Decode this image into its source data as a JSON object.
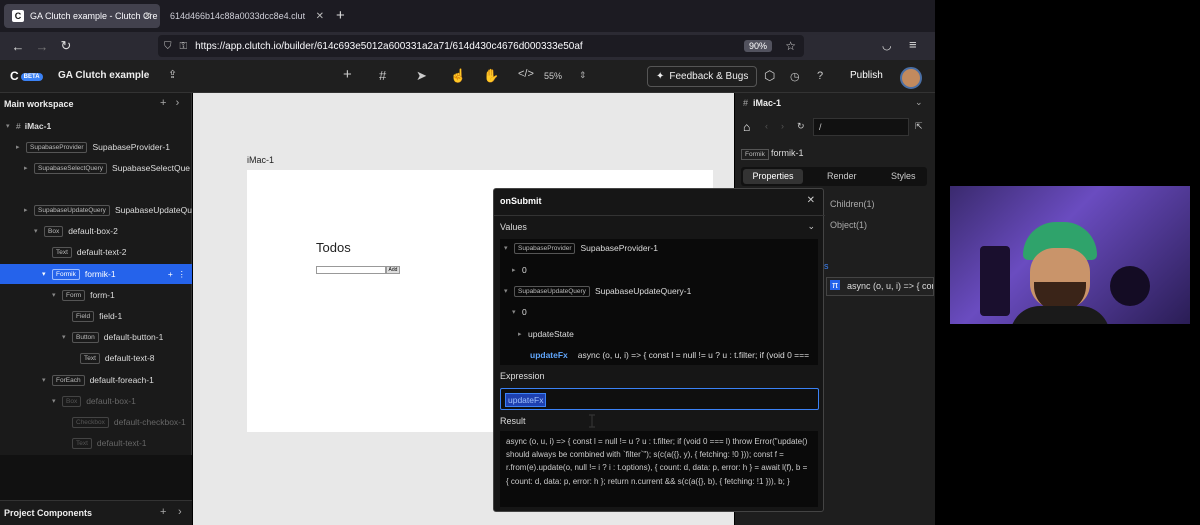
{
  "browser": {
    "tabs": [
      {
        "title": "GA Clutch example - Clutch Cre",
        "favicon": "C"
      },
      {
        "title": "614d466b14c88a0033dcc8e4.clut"
      }
    ],
    "url": "https://app.clutch.io/builder/614c693e5012a600331a2a71/614d430c4676d000333e50af",
    "zoom": "90%"
  },
  "appbar": {
    "logo": "C",
    "badge": "BETA",
    "project": "GA Clutch example",
    "zoom": "55%",
    "feedback": "Feedback & Bugs",
    "publish": "Publish"
  },
  "left": {
    "workspace": "Main workspace",
    "root": "iMac-1",
    "tree": [
      {
        "tag": "SupabaseProvider",
        "label": "SupabaseProvider-1"
      },
      {
        "tag": "SupabaseSelectQuery",
        "label": "SupabaseSelectQue"
      },
      {
        "tag": "SupabaseUpdateQuery",
        "label": "SupabaseUpdateQu"
      },
      {
        "tag": "Box",
        "label": "default-box-2"
      },
      {
        "tag": "Text",
        "label": "default-text-2"
      },
      {
        "tag": "Formik",
        "label": "formik-1"
      },
      {
        "tag": "Form",
        "label": "form-1"
      },
      {
        "tag": "Field",
        "label": "field-1"
      },
      {
        "tag": "Button",
        "label": "default-button-1"
      },
      {
        "tag": "Text",
        "label": "default-text-8"
      },
      {
        "tag": "ForEach",
        "label": "default-foreach-1"
      },
      {
        "tag": "Box",
        "label": "default-box-1"
      },
      {
        "tag": "Checkbox",
        "label": "default-checkbox-1"
      },
      {
        "tag": "Text",
        "label": "default-text-1"
      }
    ],
    "project_components": "Project Components"
  },
  "canvas": {
    "artboard": "iMac-1",
    "heading": "Todos",
    "add_button": "Add"
  },
  "right": {
    "title": "iMac-1",
    "path": "/",
    "component_tag": "Formik",
    "component_name": "formik-1",
    "tabs": [
      "Properties",
      "Render",
      "Styles"
    ],
    "children": "Children(1)",
    "object": "Object(1)",
    "fn_preview": "async (o, u, i) => { cons"
  },
  "modal": {
    "title": "onSubmit",
    "values_label": "Values",
    "values": [
      {
        "tag": "SupabaseProvider",
        "label": "SupabaseProvider-1"
      },
      {
        "label": "0"
      },
      {
        "tag": "SupabaseUpdateQuery",
        "label": "SupabaseUpdateQuery-1"
      },
      {
        "label": "0"
      },
      {
        "label": "updateState"
      },
      {
        "key": "updateFx",
        "value": "async (o, u, i) => { const l = null != u ? u : t.filter; if (void 0 ==="
      }
    ],
    "expression_label": "Expression",
    "expression": "updateFx",
    "result_label": "Result",
    "result": "async (o, u, i) => { const l = null != u ? u : t.filter; if (void 0 === l) throw Error(\"update() should always be combined with `filter`\"); s(c(a({}, y), { fetching: !0 })); const f = r.from(e).update(o, null != i ? i : t.options), { count: d, data: p, error: h } = await l(f), b = { count: d, data: p, error: h }; return n.current && s(c(a({}, b), { fetching: !1 })), b; }"
  }
}
